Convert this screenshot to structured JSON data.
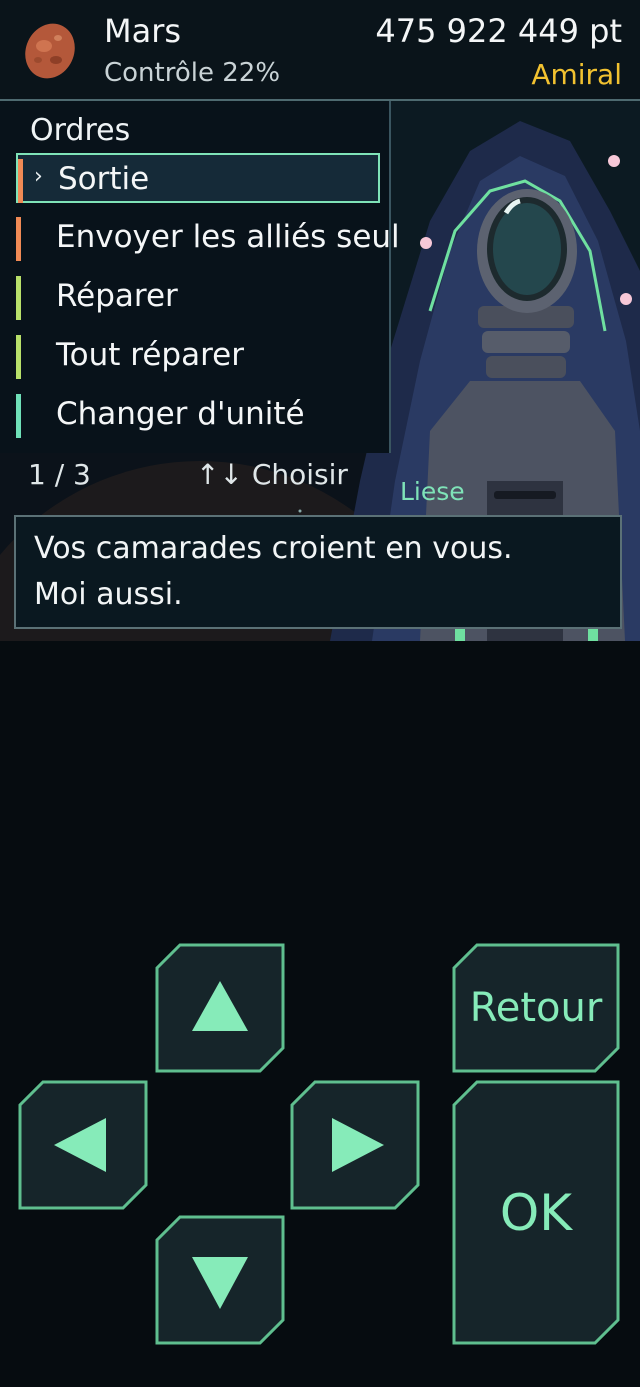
{
  "header": {
    "planet_name": "Mars",
    "control": "Contrôle 22%",
    "points": "475 922 449 pt",
    "rank": "Amiral",
    "planet_icon": "mars-planet-icon"
  },
  "menu": {
    "title": "Ordres",
    "items": [
      {
        "label": "Sortie",
        "accent": "#f08a55",
        "selected": true
      },
      {
        "label": "Envoyer les alliés seul",
        "accent": "#f08a55",
        "selected": false
      },
      {
        "label": "Réparer",
        "accent": "#b8e06a",
        "selected": false
      },
      {
        "label": "Tout réparer",
        "accent": "#b8e06a",
        "selected": false
      },
      {
        "label": "Changer d'unité",
        "accent": "#6fe0b8",
        "selected": false
      }
    ],
    "page": "1 / 3",
    "hint": "↑↓ Choisir"
  },
  "dialog": {
    "speaker": "Liese",
    "lines": [
      "Vos camarades croient en vous.",
      "Moi aussi."
    ]
  },
  "controls": {
    "back_label": "Retour",
    "ok_label": "OK",
    "accent": "#86ebb9",
    "button_fill": "#16252a",
    "button_border": "#5fbf8f"
  }
}
